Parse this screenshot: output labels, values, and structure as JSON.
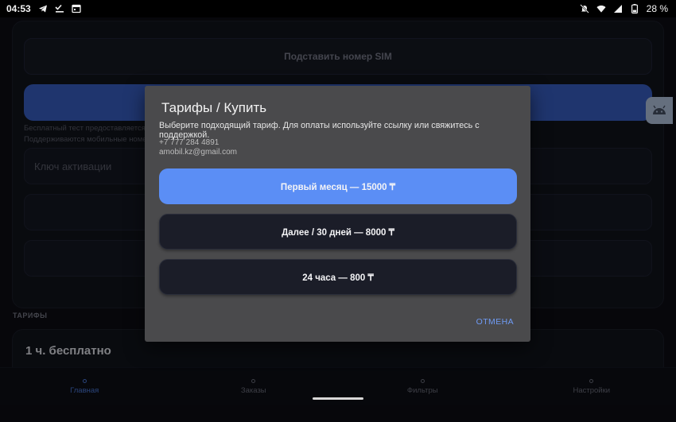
{
  "status_bar": {
    "time": "04:53",
    "left_icons": [
      "telegram-icon",
      "checklist-icon",
      "calendar-icon"
    ],
    "right_icons": [
      "mute-icon",
      "wifi-icon",
      "signal-icon",
      "battery-icon"
    ],
    "battery": "28 %"
  },
  "background": {
    "sim_button_label": "Подставить номер SIM",
    "note_line1": "Бесплатный тест предоставляется с",
    "note_line2": "Поддерживаются мобильные номер",
    "activation_placeholder": "Ключ активации",
    "section_label": "ТАРИФЫ",
    "plan_title": "1 ч. бесплатно"
  },
  "bottom_nav": {
    "items": [
      {
        "label": "Главная",
        "icon": "home-icon"
      },
      {
        "label": "Заказы",
        "icon": "orders-icon"
      },
      {
        "label": "Фильтры",
        "icon": "filter-icon"
      },
      {
        "label": "Настройки",
        "icon": "gear-icon"
      }
    ]
  },
  "dialog": {
    "title": "Тарифы / Купить",
    "message": "Выберите подходящий тариф. Для оплаты используйте ссылку или свяжитесь с поддержкой.",
    "phone": "+7 777 284 4891",
    "email": "amobil.kz@gmail.com",
    "options": [
      {
        "label": "Первый месяц — 15000 ₸"
      },
      {
        "label": "Далее / 30 дней — 8000 ₸"
      },
      {
        "label": "24 часа — 800 ₸"
      }
    ],
    "cancel_label": "ОТМЕНА"
  },
  "colors": {
    "accent": "#5b8ef5",
    "dialog_bg": "#4a4a4c",
    "app_bg": "#0d0e14"
  }
}
